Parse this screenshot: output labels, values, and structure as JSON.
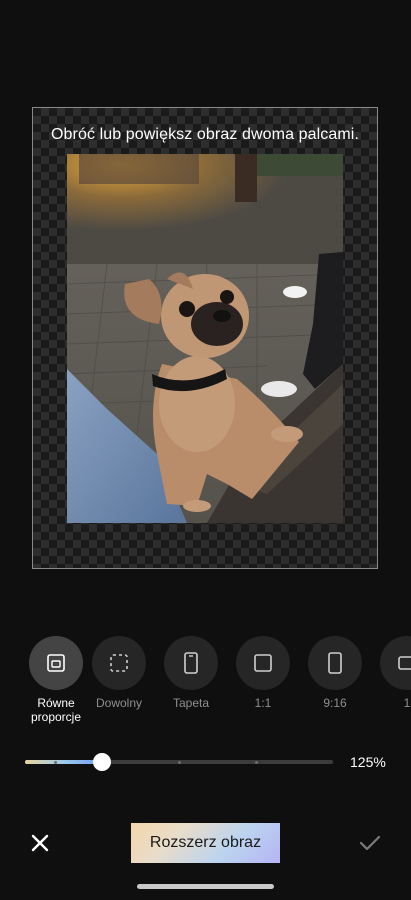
{
  "editor": {
    "hint": "Obróć lub powiększ obraz dwoma palcami.",
    "photo_description": "photo-of-dog"
  },
  "formats": [
    {
      "label": "Równe proporcje",
      "icon": "equal-ratio-icon",
      "selected": true
    },
    {
      "label": "Dowolny",
      "icon": "freeform-crop-icon",
      "selected": false
    },
    {
      "label": "Tapeta",
      "icon": "wallpaper-phone-icon",
      "selected": false
    },
    {
      "label": "1:1",
      "icon": "square-ratio-icon",
      "selected": false
    },
    {
      "label": "9:16",
      "icon": "portrait-ratio-icon",
      "selected": false
    },
    {
      "label": "1",
      "icon": "ratio-icon",
      "selected": false
    }
  ],
  "zoom": {
    "value_label": "125%",
    "level_fraction": 0.25
  },
  "actions": {
    "expand_label": "Rozszerz obraz",
    "close_icon": "close-icon",
    "confirm_icon": "check-icon"
  },
  "colors": {
    "background": "#0f0f0f",
    "accent_gradient": [
      "#f3d6a9",
      "#bcd4ef",
      "#b5b4f4"
    ]
  }
}
